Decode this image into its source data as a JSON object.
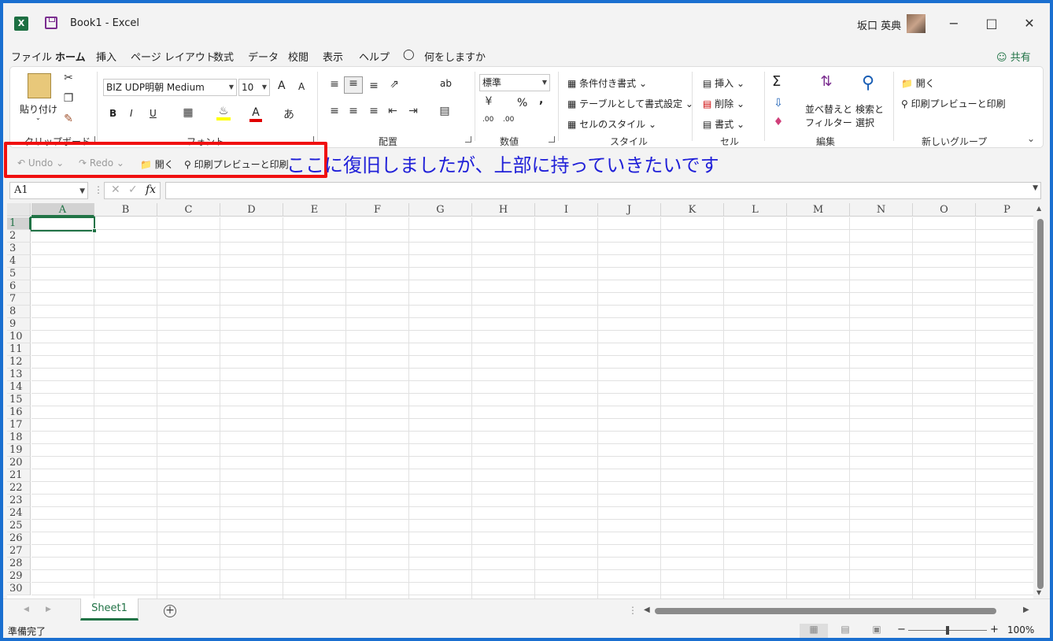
{
  "titlebar": {
    "app_logo": "X",
    "document": "Book1  -  Excel",
    "user": "坂口 英典",
    "minimize": "−",
    "maximize": "□",
    "close": "✕"
  },
  "menu": {
    "items": [
      "ファイル",
      "ホーム",
      "挿入",
      "ページ レイアウト",
      "数式",
      "データ",
      "校閲",
      "表示",
      "ヘルプ"
    ],
    "tell_me": "何をしますか",
    "share": "共有"
  },
  "ribbon": {
    "clipboard": {
      "paste": "貼り付け",
      "label": "クリップボード"
    },
    "font": {
      "name": "BIZ UDP明朝 Medium",
      "size": "10",
      "grow": "A",
      "shrink": "A",
      "bold": "B",
      "italic": "I",
      "underline": "U",
      "font_color": "A",
      "label": "フォント"
    },
    "alignment": {
      "label": "配置",
      "wrap": "ab"
    },
    "number": {
      "format": "標準",
      "percent": "%",
      "comma": ",",
      "inc_decimal": ".00",
      "dec_decimal": ".00",
      "label": "数値"
    },
    "styles": {
      "conditional": "条件付き書式",
      "table": "テーブルとして書式設定",
      "cell": "セルのスタイル",
      "label": "スタイル"
    },
    "cells": {
      "insert": "挿入",
      "delete": "削除",
      "format": "書式",
      "label": "セル"
    },
    "editing": {
      "sort_line1": "並べ替えと",
      "sort_line2": "フィルター",
      "find_line1": "検索と",
      "find_line2": "選択",
      "label": "編集",
      "sum": "Σ"
    },
    "new_group": {
      "open": "開く",
      "print": "印刷プレビューと印刷",
      "label": "新しいグループ"
    }
  },
  "qat": {
    "undo": "Undo",
    "redo": "Redo",
    "open": "開く",
    "print": "印刷プレビューと印刷"
  },
  "annotation": "ここに復旧しましたが、上部に持っていきたいです",
  "formula": {
    "namebox": "A1",
    "fx": "fx"
  },
  "grid": {
    "columns": [
      "A",
      "B",
      "C",
      "D",
      "E",
      "F",
      "G",
      "H",
      "I",
      "J",
      "K",
      "L",
      "M",
      "N",
      "O",
      "P"
    ],
    "rows": [
      "1",
      "2",
      "3",
      "4",
      "5",
      "6",
      "7",
      "8",
      "9",
      "10",
      "11",
      "12",
      "13",
      "14",
      "15",
      "16",
      "17",
      "18",
      "19",
      "20",
      "21",
      "22",
      "23",
      "24",
      "25",
      "26",
      "27",
      "28",
      "29",
      "30"
    ]
  },
  "sheets": {
    "tab": "Sheet1",
    "add": "+"
  },
  "status": {
    "ready": "準備完了",
    "zoom": "100%",
    "zoom_minus": "−",
    "zoom_plus": "+"
  },
  "colors": {
    "accent": "#217346",
    "annotation_box": "#f01010",
    "annotation_text": "#2020d8"
  }
}
